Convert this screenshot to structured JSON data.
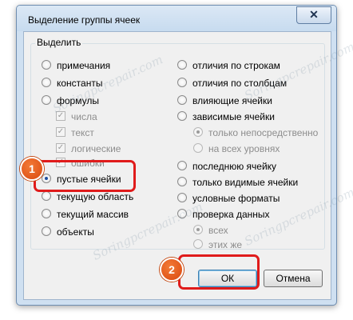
{
  "dialog": {
    "title": "Выделение группы ячеек",
    "close_glyph": "✕",
    "group_label": "Выделить"
  },
  "options_left": [
    {
      "label": "примечания",
      "checked": false
    },
    {
      "label": "константы",
      "checked": false
    },
    {
      "label": "формулы",
      "checked": false
    },
    {
      "label": "числа",
      "type": "checkbox",
      "checked": true,
      "disabled": true
    },
    {
      "label": "текст",
      "type": "checkbox",
      "checked": true,
      "disabled": true
    },
    {
      "label": "логические",
      "type": "checkbox",
      "checked": true,
      "disabled": true
    },
    {
      "label": "ошибки",
      "type": "checkbox",
      "checked": true,
      "disabled": true
    },
    {
      "label": "пустые ячейки",
      "checked": true
    },
    {
      "label": "текущую область",
      "checked": false
    },
    {
      "label": "текущий массив",
      "checked": false
    },
    {
      "label": "объекты",
      "checked": false
    }
  ],
  "options_right": [
    {
      "label": "отличия по строкам",
      "checked": false
    },
    {
      "label": "отличия по столбцам",
      "checked": false
    },
    {
      "label": "влияющие ячейки",
      "checked": false
    },
    {
      "label": "зависимые ячейки",
      "checked": false
    },
    {
      "label": "только непосредственно",
      "checked": true,
      "disabled": true
    },
    {
      "label": "на всех уровнях",
      "checked": false,
      "disabled": true
    },
    {
      "label": "последнюю ячейку",
      "checked": false
    },
    {
      "label": "только видимые ячейки",
      "checked": false
    },
    {
      "label": "условные форматы",
      "checked": false
    },
    {
      "label": "проверка данных",
      "checked": false
    },
    {
      "label": "всех",
      "checked": true,
      "disabled": true
    },
    {
      "label": "этих же",
      "checked": false,
      "disabled": true
    }
  ],
  "buttons": {
    "ok": "ОК",
    "cancel": "Отмена"
  },
  "annotations": {
    "step1": "1",
    "step2": "2",
    "highlight_color": "#e01b1b",
    "badge_color": "#e8621c"
  },
  "watermark": "Soringpcrepair.com"
}
